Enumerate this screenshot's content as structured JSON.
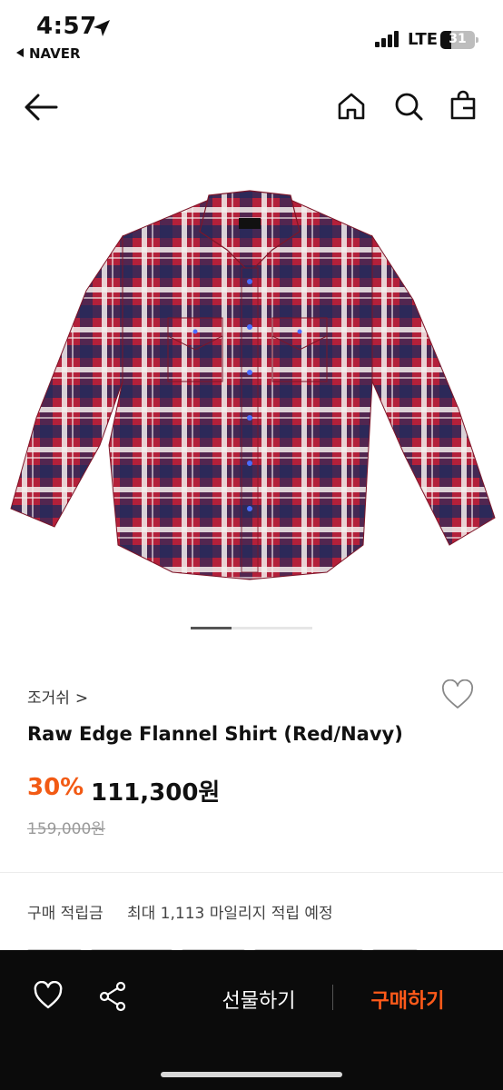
{
  "status_bar": {
    "time": "4:57",
    "back_app": "NAVER",
    "network": "LTE",
    "battery": "31",
    "battery_level": 0.31
  },
  "nav": {
    "back_icon": "arrow-left-icon",
    "home_icon": "home-icon",
    "search_icon": "search-icon",
    "bag_icon": "shopping-bag-icon"
  },
  "product": {
    "image_name": "plaid-flannel-shirt",
    "colors": {
      "red": "#b3203a",
      "navy": "#1f2a5c",
      "white": "#f3f0ee"
    },
    "gallery_index": 1,
    "gallery_total": 3,
    "brand": "조거쉬",
    "brand_chevron": ">",
    "name": "Raw Edge Flannel Shirt (Red/Navy)",
    "discount": "30%",
    "price": "111,300원",
    "original_price": "159,000원"
  },
  "points": {
    "label": "구매 적립금",
    "value": "최대 1,113 마일리지 적립 예정"
  },
  "bottom_bar": {
    "wish_icon": "heart-icon",
    "share_icon": "share-icon",
    "gift_label": "선물하기",
    "buy_label": "구매하기",
    "buy_color": "#ff5a1a"
  }
}
